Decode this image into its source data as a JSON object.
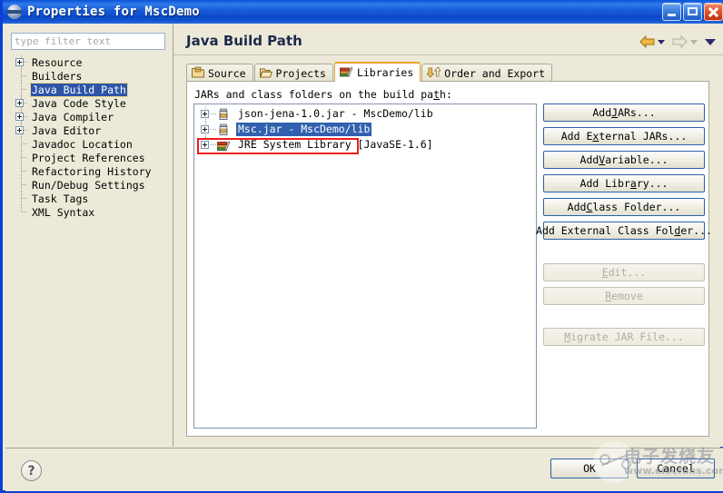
{
  "window": {
    "title": "Properties for MscDemo",
    "icon": "eclipse-icon",
    "buttons": {
      "minimize": "minimize-button",
      "maximize": "maximize-button",
      "close": "close-button"
    }
  },
  "sidebar": {
    "filter": {
      "value": "",
      "placeholder": "type filter text"
    },
    "items": [
      {
        "label": "Resource",
        "expandable": true,
        "selected": false
      },
      {
        "label": "Builders",
        "expandable": false,
        "selected": false
      },
      {
        "label": "Java Build Path",
        "expandable": false,
        "selected": true
      },
      {
        "label": "Java Code Style",
        "expandable": true,
        "selected": false
      },
      {
        "label": "Java Compiler",
        "expandable": true,
        "selected": false
      },
      {
        "label": "Java Editor",
        "expandable": true,
        "selected": false
      },
      {
        "label": "Javadoc Location",
        "expandable": false,
        "selected": false
      },
      {
        "label": "Project References",
        "expandable": false,
        "selected": false
      },
      {
        "label": "Refactoring History",
        "expandable": false,
        "selected": false
      },
      {
        "label": "Run/Debug Settings",
        "expandable": false,
        "selected": false
      },
      {
        "label": "Task Tags",
        "expandable": false,
        "selected": false
      },
      {
        "label": "XML Syntax",
        "expandable": false,
        "selected": false
      }
    ]
  },
  "main": {
    "title": "Java Build Path",
    "nav": {
      "back": "back-arrow",
      "back_menu": "back-dropdown",
      "forward": "forward-arrow",
      "forward_menu": "forward-dropdown",
      "menu": "view-menu"
    },
    "tabs": [
      {
        "label": "Source",
        "icon": "source-folder-icon",
        "active": false
      },
      {
        "label": "Projects",
        "icon": "open-folder-icon",
        "active": false
      },
      {
        "label": "Libraries",
        "icon": "books-icon",
        "active": true
      },
      {
        "label": "Order and Export",
        "icon": "order-export-icon",
        "active": false
      }
    ],
    "list_caption_pre": "JARs and class folders on the build pa",
    "list_caption_mnemonic": "t",
    "list_caption_post": "h:",
    "entries": [
      {
        "label": "json-jena-1.0.jar - MscDemo/lib",
        "icon": "jar-icon",
        "expandable": true,
        "selected": false,
        "annotated": false
      },
      {
        "label": "Msc.jar - MscDemo/lib",
        "icon": "jar-icon",
        "expandable": true,
        "selected": true,
        "annotated": true
      },
      {
        "label": "JRE System Library [JavaSE-1.6]",
        "icon": "jre-library-icon",
        "expandable": true,
        "selected": false,
        "annotated": false
      }
    ],
    "buttons": [
      {
        "pre": "Add ",
        "mn": "J",
        "post": "ARs...",
        "disabled": false,
        "name": "add-jars-button"
      },
      {
        "pre": "Add E",
        "mn": "x",
        "post": "ternal JARs...",
        "disabled": false,
        "name": "add-external-jars-button"
      },
      {
        "pre": "Add ",
        "mn": "V",
        "post": "ariable...",
        "disabled": false,
        "name": "add-variable-button"
      },
      {
        "pre": "Add Libr",
        "mn": "a",
        "post": "ry...",
        "disabled": false,
        "name": "add-library-button"
      },
      {
        "pre": "Add ",
        "mn": "C",
        "post": "lass Folder...",
        "disabled": false,
        "name": "add-class-folder-button"
      },
      {
        "pre": "Add External Class Fol",
        "mn": "d",
        "post": "er...",
        "disabled": false,
        "name": "add-external-class-folder-button"
      },
      {
        "pre": "",
        "mn": "E",
        "post": "dit...",
        "disabled": true,
        "name": "edit-button"
      },
      {
        "pre": "",
        "mn": "R",
        "post": "emove",
        "disabled": true,
        "name": "remove-button"
      },
      {
        "pre": "",
        "mn": "M",
        "post": "igrate JAR File...",
        "disabled": true,
        "name": "migrate-jar-file-button"
      }
    ]
  },
  "footer": {
    "help": "?",
    "ok": "OK",
    "cancel": "Cancel"
  },
  "watermark": {
    "cn": "电子发烧友",
    "url": "www.elecfans.com"
  },
  "colors": {
    "title_bar": "#0a3fd1",
    "accent_tab": "#e8a12c",
    "selection": "#3160ae",
    "annotation": "#ee1d1d",
    "dialog_bg": "#ece9d8"
  }
}
